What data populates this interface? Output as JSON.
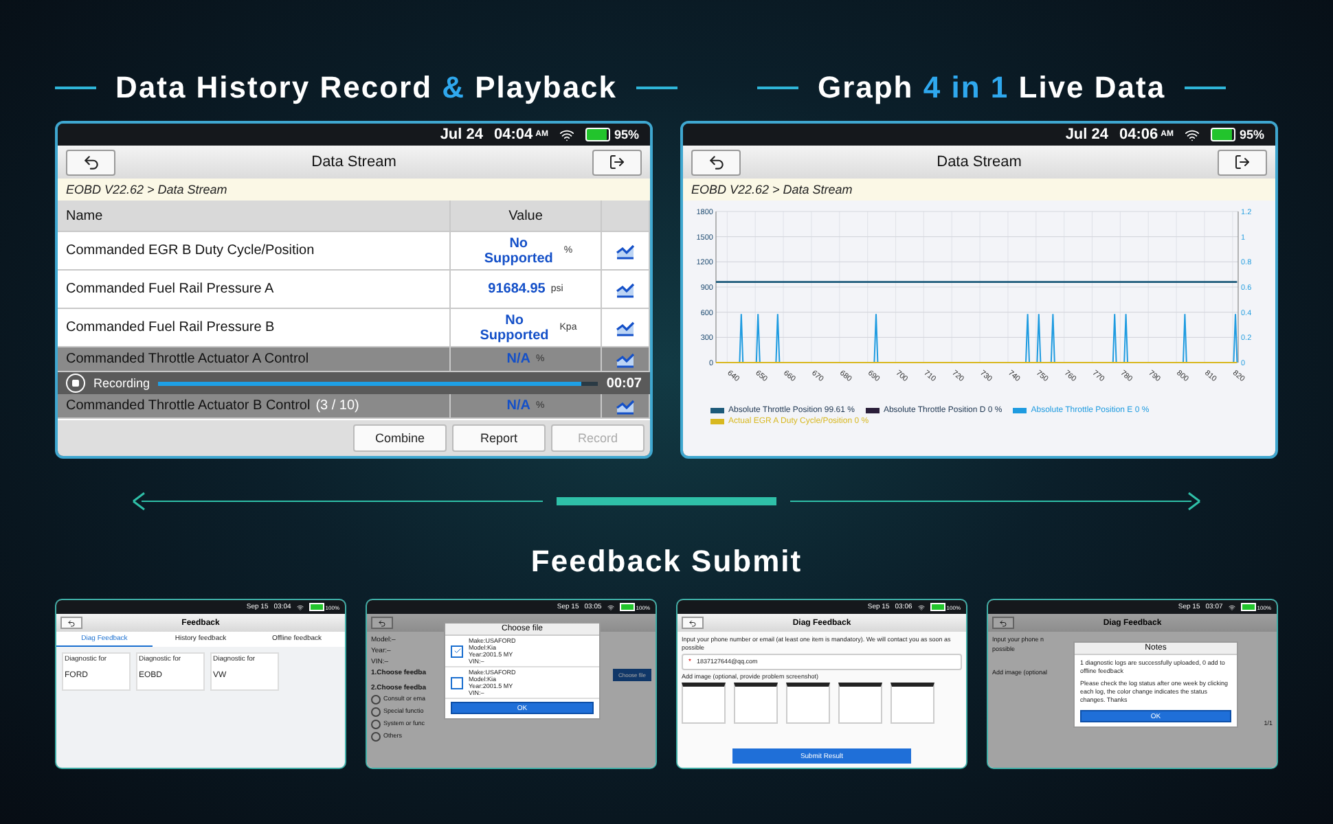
{
  "headings": [
    {
      "parts": [
        {
          "text": "Data History Record ",
          "accent": false
        },
        {
          "text": "&",
          "accent": true
        },
        {
          "text": " Playback",
          "accent": false
        }
      ]
    },
    {
      "parts": [
        {
          "text": "Graph ",
          "accent": false
        },
        {
          "text": "4",
          "accent": true
        },
        {
          "text": " in ",
          "accent": true
        },
        {
          "text": "1",
          "accent": true
        },
        {
          "text": " Live Data",
          "accent": false
        }
      ]
    }
  ],
  "stream_screen": {
    "status": {
      "date": "Jul 24",
      "time": "04:04",
      "ampm": "AM",
      "battery": "95%"
    },
    "title": "Data Stream",
    "breadcrumb": "EOBD V22.62 > Data Stream",
    "columns": [
      "Name",
      "Value"
    ],
    "rows": [
      {
        "name": "Commanded EGR B Duty Cycle/Position",
        "value": "No Supported",
        "unit": "%",
        "dimmed": false
      },
      {
        "name": "Commanded Fuel Rail Pressure A",
        "value": "91684.95",
        "unit": "psi",
        "dimmed": false
      },
      {
        "name": "Commanded Fuel Rail Pressure B",
        "value": "No Supported",
        "unit": "Kpa",
        "dimmed": false
      },
      {
        "name": "Commanded Throttle Actuator A Control",
        "value": "N/A",
        "unit": "%",
        "dimmed": true
      },
      {
        "name": "Commanded Throttle Actuator B Control",
        "value": "N/A",
        "unit": "%",
        "dimmed": true
      }
    ],
    "recording": {
      "label": "Recording",
      "page": "(3 / 10)",
      "elapsed": "00:07",
      "level": 0.96
    },
    "buttons": [
      {
        "label": "Combine",
        "disabled": false
      },
      {
        "label": "Report",
        "disabled": false
      },
      {
        "label": "Record",
        "disabled": true
      }
    ]
  },
  "graph_screen": {
    "status": {
      "date": "Jul 24",
      "time": "04:06",
      "ampm": "AM",
      "battery": "95%"
    },
    "title": "Data Stream",
    "breadcrumb": "EOBD V22.62 > Data Stream",
    "chart_data": {
      "type": "line",
      "xlim": [
        636,
        822
      ],
      "ylim": [
        0,
        1800
      ],
      "xticks": [
        640,
        650,
        660,
        670,
        680,
        690,
        700,
        710,
        720,
        730,
        740,
        750,
        760,
        770,
        780,
        790,
        800,
        810,
        820
      ],
      "yticks": [
        0,
        300,
        600,
        900,
        1200,
        1500,
        1800
      ],
      "y2lim": [
        0,
        1.2
      ],
      "y2ticks": [
        0,
        0.2,
        0.4,
        0.6,
        0.8,
        1,
        1.2
      ],
      "grid": true,
      "legend": "bottom",
      "x": [
        636,
        644.4,
        645,
        645.6,
        648,
        650.4,
        651,
        651.6,
        654,
        657.4,
        658,
        658.6,
        670,
        692.4,
        693,
        693.6,
        720,
        746.4,
        747,
        747.6,
        749,
        750.4,
        751,
        751.6,
        753,
        755.4,
        756,
        756.6,
        767,
        777.4,
        778,
        778.6,
        780,
        781.4,
        782,
        782.6,
        790,
        802.4,
        803,
        803.6,
        812,
        820.4,
        821,
        821.6
      ],
      "series": [
        {
          "name": "Absolute Throttle Position 99.61 %",
          "color": "#1d5a7a",
          "values": [
            960,
            960,
            960,
            960,
            960,
            960,
            960,
            960,
            960,
            960,
            960,
            960,
            960,
            960,
            960,
            960,
            960,
            960,
            960,
            960,
            960,
            960,
            960,
            960,
            960,
            960,
            960,
            960,
            960,
            960,
            960,
            960,
            960,
            960,
            960,
            960,
            960,
            960,
            960,
            960,
            960,
            960,
            960,
            960
          ]
        },
        {
          "name": "Absolute Throttle Position D 0 %",
          "color": "#2a1e3a",
          "values": [
            null,
            null,
            null,
            null,
            null,
            null,
            null,
            null,
            null,
            null,
            null,
            null,
            null,
            null,
            null,
            null,
            null,
            null,
            null,
            null,
            null,
            null,
            null,
            null,
            null,
            null,
            null,
            null,
            null,
            null,
            null,
            null,
            null,
            null,
            null,
            null,
            null,
            null,
            null,
            null,
            null,
            null,
            null,
            null
          ]
        },
        {
          "name": "Absolute Throttle Position E 0 %",
          "color": "#1e9be0",
          "values": [
            null,
            0,
            580,
            0,
            null,
            0,
            580,
            0,
            null,
            0,
            580,
            0,
            null,
            0,
            580,
            0,
            null,
            0,
            580,
            0,
            null,
            0,
            580,
            0,
            null,
            0,
            580,
            0,
            null,
            0,
            580,
            0,
            null,
            0,
            580,
            0,
            null,
            0,
            580,
            0,
            null,
            0,
            580,
            0
          ]
        },
        {
          "name": "Actual EGR A Duty Cycle/Position 0 %",
          "color": "#d8b820",
          "values": [
            0,
            0,
            0,
            0,
            0,
            0,
            0,
            0,
            0,
            0,
            0,
            0,
            0,
            0,
            0,
            0,
            0,
            0,
            0,
            0,
            0,
            0,
            0,
            0,
            0,
            0,
            0,
            0,
            0,
            0,
            0,
            0,
            0,
            0,
            0,
            0,
            0,
            0,
            0,
            0,
            0,
            0,
            0,
            0
          ]
        }
      ]
    }
  },
  "feedback_heading": "Feedback Submit",
  "thumbs": [
    {
      "kind": "tabs",
      "status": {
        "date": "Sep 15",
        "time": "03:04",
        "battery": "100%"
      },
      "title": "Feedback",
      "tabs": [
        {
          "label": "Diag Feedback",
          "selected": true
        },
        {
          "label": "History feedback",
          "selected": false
        },
        {
          "label": "Offline feedback",
          "selected": false
        }
      ],
      "cards": [
        {
          "caption": "Diagnostic for",
          "name": "FORD"
        },
        {
          "caption": "Diagnostic for",
          "name": "EOBD"
        },
        {
          "caption": "Diagnostic for",
          "name": "VW"
        }
      ]
    },
    {
      "kind": "choose",
      "status": {
        "date": "Sep 15",
        "time": "03:05",
        "battery": "100%"
      },
      "background": [
        "Model:–",
        "Year:–",
        "VIN:–",
        "1.Choose feedba",
        "2.Choose feedba"
      ],
      "options": [
        {
          "label": "Consult or ema",
          "selected": false
        },
        {
          "label": "Special functio",
          "selected": false
        },
        {
          "label": "System or func",
          "selected": false
        },
        {
          "label": "Others",
          "selected": false
        }
      ],
      "side_button": "Choose file",
      "dialog": {
        "title": "Choose file",
        "files": [
          {
            "lines": [
              "Make:USAFORD",
              "Model:Kia",
              "Year:2001.5 MY",
              "VIN:–"
            ],
            "checked": true
          },
          {
            "lines": [
              "Make:USAFORD",
              "Model:Kia",
              "Year:2001.5 MY",
              "VIN:–"
            ],
            "checked": false
          }
        ],
        "ok": "OK"
      }
    },
    {
      "kind": "form",
      "status": {
        "date": "Sep 15",
        "time": "03:06",
        "battery": "100%"
      },
      "title": "Diag Feedback",
      "intro": "Input your phone number or email (at least one item is mandatory). We will contact you as soon as possible",
      "required_mark": "*",
      "contact": "1837127644@qq.com",
      "image_label": "Add image (optional, provide problem screenshot)",
      "submit": "Submit Result"
    },
    {
      "kind": "notes",
      "status": {
        "date": "Sep 15",
        "time": "03:07",
        "battery": "100%"
      },
      "title": "Diag Feedback",
      "background": [
        "Input your phone n",
        "possible",
        "Add image (optional"
      ],
      "pager": "1/1",
      "dialog": {
        "title": "Notes",
        "paragraphs": [
          "1 diagnostic logs are successfully uploaded, 0 add to offline feedback",
          "Please check the log status after one week by clicking each log, the color change indicates the status changes. Thanks"
        ],
        "ok": "OK"
      }
    }
  ]
}
